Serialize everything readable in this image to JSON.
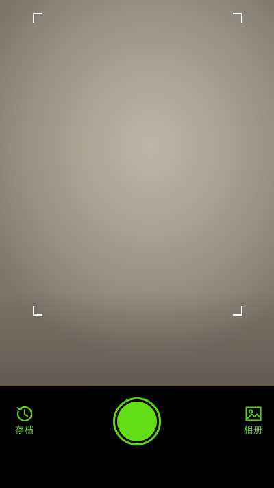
{
  "camera": {
    "accent_color": "#5fd31a"
  },
  "controls": {
    "archive_label": "存档",
    "archive_icon": "history-icon",
    "album_label": "相册",
    "album_icon": "image-icon",
    "shutter_icon": "shutter-button"
  }
}
